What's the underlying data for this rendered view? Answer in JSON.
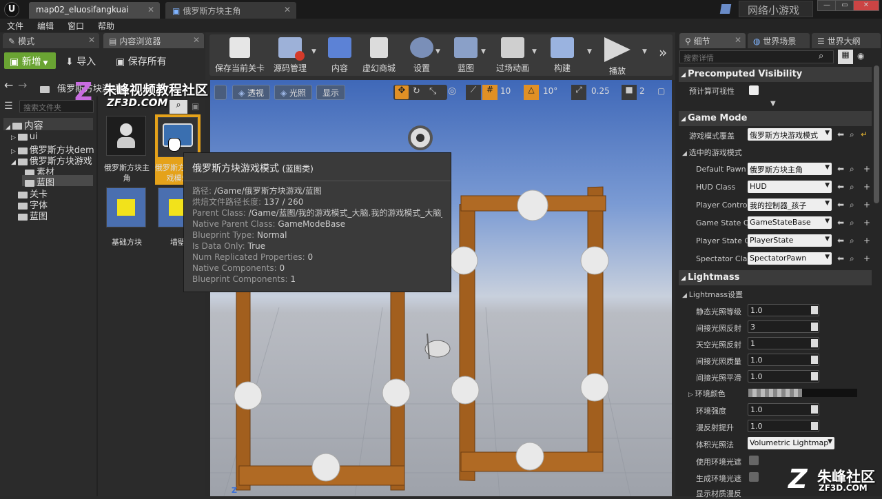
{
  "titlebar": {
    "tabs": [
      "map02_eluosifangkuai",
      "俄罗斯方块主角"
    ],
    "project_name": "网络小游戏",
    "window_controls": [
      "—",
      "▭",
      "✕"
    ]
  },
  "menubar": {
    "items": [
      "文件",
      "编辑",
      "窗口",
      "帮助"
    ]
  },
  "left_panel": {
    "tabs": [
      "模式",
      "内容浏览器"
    ],
    "add_button": "新增",
    "import_button": "导入",
    "save_all_button": "保存所有",
    "breadcrumb": "俄罗斯方块游戏",
    "search_placeholder": "搜索文件夹",
    "tree": [
      "内容",
      "ui",
      "俄罗斯方块dem",
      "俄罗斯方块游戏",
      "素材",
      "蓝图",
      "关卡",
      "字体",
      "蓝图"
    ],
    "assets": [
      "俄罗斯方块主角",
      "俄罗斯方块游戏模式",
      "基础方块",
      "墙壁"
    ]
  },
  "toolbar": {
    "buttons": [
      "保存当前关卡",
      "源码管理",
      "内容",
      "虚幻商城",
      "设置",
      "蓝图",
      "过场动画",
      "构建",
      "播放"
    ]
  },
  "viewport": {
    "perspective": "透视",
    "lit": "光照",
    "show": "显示",
    "grid_snap": "10",
    "rotation_snap": "10°",
    "scale_snap": "0.25",
    "camera_speed": "2",
    "axis_label": "Z"
  },
  "tooltip": {
    "title": "俄罗斯方块游戏模式",
    "title_suffix": "(蓝图类)",
    "rows": [
      {
        "k": "路径:",
        "v": "/Game/俄罗斯方块游戏/蓝图"
      },
      {
        "k": "烘焙文件路径长度:",
        "v": "137 / 260"
      },
      {
        "k": "Parent Class:",
        "v": "/Game/蓝图/我的游戏模式_大脑.我的游戏模式_大脑_C"
      },
      {
        "k": "Native Parent Class:",
        "v": "GameModeBase"
      },
      {
        "k": "Blueprint Type:",
        "v": "Normal"
      },
      {
        "k": "Is Data Only:",
        "v": "True"
      },
      {
        "k": "Num Replicated Properties:",
        "v": "0"
      },
      {
        "k": "Native Components:",
        "v": "0"
      },
      {
        "k": "Blueprint Components:",
        "v": "1"
      }
    ]
  },
  "details": {
    "tabs": [
      "细节",
      "世界场景",
      "世界大纲"
    ],
    "search_placeholder": "搜索详情",
    "sections": {
      "precomputed": {
        "title": "Precomputed Visibility",
        "label": "预计算可视性"
      },
      "game_mode": {
        "title": "Game Mode",
        "override_label": "游戏模式覆盖",
        "override_value": "俄罗斯方块游戏模式",
        "selected_label": "选中的游戏模式",
        "rows": [
          {
            "label": "Default Pawn",
            "value": "俄罗斯方块主角"
          },
          {
            "label": "HUD Class",
            "value": "HUD"
          },
          {
            "label": "Player Contro",
            "value": "我的控制器_孩子"
          },
          {
            "label": "Game State C",
            "value": "GameStateBase"
          },
          {
            "label": "Player State C",
            "value": "PlayerState"
          },
          {
            "label": "Spectator Cla",
            "value": "SpectatorPawn"
          }
        ]
      },
      "lightmass": {
        "title": "Lightmass",
        "settings_label": "Lightmass设置",
        "rows": [
          {
            "label": "静态光照等级",
            "value": "1.0"
          },
          {
            "label": "间接光照反射",
            "value": "3"
          },
          {
            "label": "天空光照反射",
            "value": "1"
          },
          {
            "label": "间接光照质量",
            "value": "1.0"
          },
          {
            "label": "间接光照平滑",
            "value": "1.0"
          }
        ],
        "env_color_label": "环境颜色",
        "env_intensity_label": "环境强度",
        "env_intensity_value": "1.0",
        "diffuse_boost_label": "漫反射提升",
        "diffuse_boost_value": "1.0",
        "volumetric_label": "体积光照法",
        "volumetric_value": "Volumetric Lightmap",
        "use_ao_label": "使用环境光遮",
        "gen_ao_label": "生成环境光遮",
        "visualize_label": "显示材质漫反"
      }
    }
  },
  "watermarks": {
    "top_text": "朱峰视频教程社区",
    "top_url": "ZF3D.COM",
    "bottom_text": "朱峰社区",
    "bottom_url": "ZF3D.COM"
  }
}
